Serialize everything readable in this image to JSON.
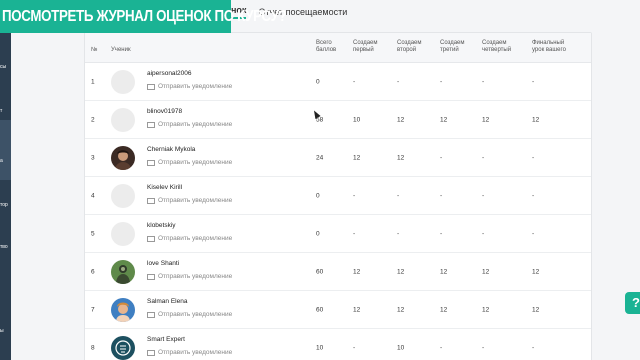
{
  "banner": {
    "text": "ПОСМОТРЕТЬ ЖУРНАЛ ОЦЕНОК ПО КУРСУ?"
  },
  "tabs": {
    "active_fragment": "нок",
    "attendance": "Отчет посещаемости"
  },
  "sidebar": {
    "fragments": [
      "сы",
      "т",
      "а",
      "тор",
      "тво",
      "ы"
    ]
  },
  "table": {
    "headers": {
      "num": "№",
      "student": "Ученик",
      "total": [
        "Всего",
        "баллов"
      ],
      "col1": [
        "Создаем",
        "первый"
      ],
      "col2": [
        "Создаем",
        "второй"
      ],
      "col3": [
        "Создаем",
        "третий"
      ],
      "col4": [
        "Создаем",
        "четвертый"
      ],
      "col5": [
        "Финальный",
        "урок вашего"
      ]
    },
    "notify_label": "Отправить уведомление",
    "rows": [
      {
        "num": "1",
        "name": "aipersonal2006",
        "avatar": "blank",
        "total": "0",
        "c1": "-",
        "c2": "-",
        "c3": "-",
        "c4": "-",
        "c5": "-"
      },
      {
        "num": "2",
        "name": "blinov01978",
        "avatar": "blank",
        "total": "58",
        "c1": "10",
        "c2": "12",
        "c3": "12",
        "c4": "12",
        "c5": "12"
      },
      {
        "num": "3",
        "name": "Cherniak Mykola",
        "avatar": "photo-dark",
        "total": "24",
        "c1": "12",
        "c2": "12",
        "c3": "-",
        "c4": "-",
        "c5": "-"
      },
      {
        "num": "4",
        "name": "Kiselev Kirill",
        "avatar": "blank",
        "total": "0",
        "c1": "-",
        "c2": "-",
        "c3": "-",
        "c4": "-",
        "c5": "-"
      },
      {
        "num": "5",
        "name": "klobetskiy",
        "avatar": "blank",
        "total": "0",
        "c1": "-",
        "c2": "-",
        "c3": "-",
        "c4": "-",
        "c5": "-"
      },
      {
        "num": "6",
        "name": "love Shanti",
        "avatar": "photo-green",
        "total": "60",
        "c1": "12",
        "c2": "12",
        "c3": "12",
        "c4": "12",
        "c5": "12"
      },
      {
        "num": "7",
        "name": "Salman Elena",
        "avatar": "photo-blue",
        "total": "60",
        "c1": "12",
        "c2": "12",
        "c3": "12",
        "c4": "12",
        "c5": "12"
      },
      {
        "num": "8",
        "name": "Smart Expert",
        "avatar": "logo-teal",
        "total": "10",
        "c1": "-",
        "c2": "10",
        "c3": "-",
        "c4": "-",
        "c5": "-"
      }
    ]
  },
  "help": {
    "label": "?"
  },
  "colors": {
    "accent": "#1ab394",
    "sidebar": "#2c3e50"
  }
}
